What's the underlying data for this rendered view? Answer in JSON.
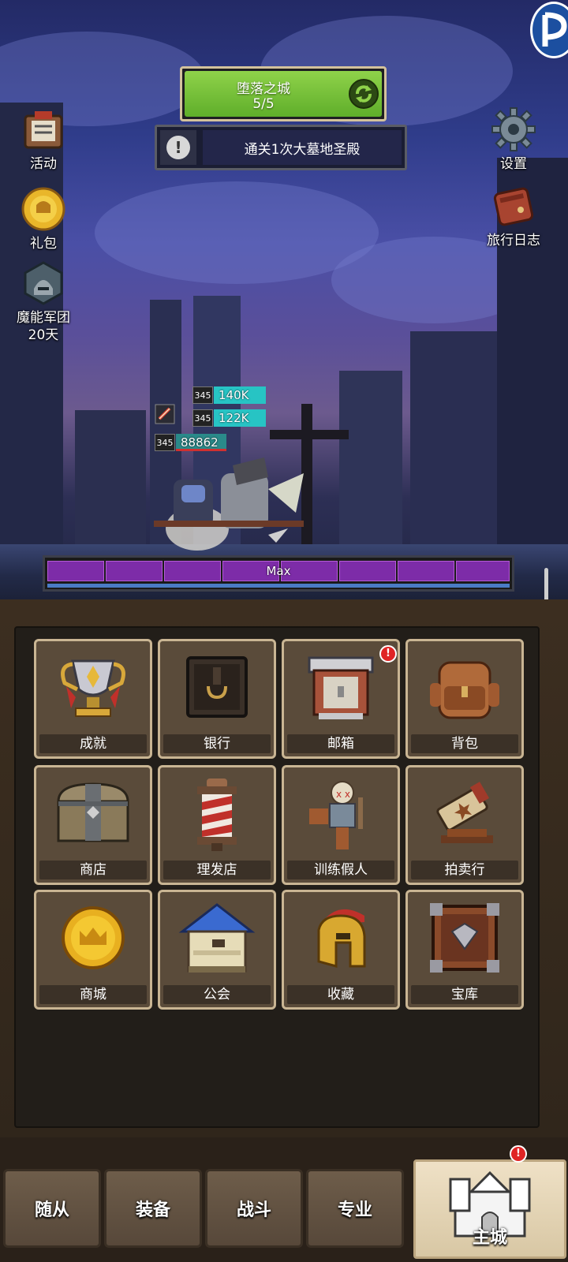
{
  "hud": {
    "stage_name": "堕落之城",
    "stage_progress": "5/5",
    "quest_text": "通关1次大墓地圣殿"
  },
  "left_menu": [
    {
      "label": "活动",
      "icon": "event-board-icon"
    },
    {
      "label": "礼包",
      "icon": "gift-pack-icon"
    },
    {
      "label": "魔能军团\n20天",
      "icon": "legion-helmet-icon"
    }
  ],
  "right_menu": [
    {
      "label": "设置",
      "icon": "gear-icon"
    },
    {
      "label": "旅行日志",
      "icon": "journal-icon"
    }
  ],
  "battle": {
    "damage_numbers": [
      {
        "level": "345",
        "value": "140K",
        "color": "#27c4c4"
      },
      {
        "level": "345",
        "value": "122K",
        "color": "#27c4c4"
      },
      {
        "level": "345",
        "value": "88862",
        "color": "#2a8a8a"
      }
    ],
    "progress_label": "Max",
    "progress_fraction": 1.0
  },
  "buildings": [
    {
      "label": "成就",
      "icon": "trophy-icon",
      "badge": false
    },
    {
      "label": "银行",
      "icon": "vault-safe-icon",
      "badge": false
    },
    {
      "label": "邮箱",
      "icon": "mailbox-icon",
      "badge": true
    },
    {
      "label": "背包",
      "icon": "backpack-icon",
      "badge": false
    },
    {
      "label": "商店",
      "icon": "chest-icon",
      "badge": false
    },
    {
      "label": "理发店",
      "icon": "barber-pole-icon",
      "badge": false
    },
    {
      "label": "训练假人",
      "icon": "training-dummy-icon",
      "badge": false
    },
    {
      "label": "拍卖行",
      "icon": "gavel-icon",
      "badge": false
    },
    {
      "label": "商城",
      "icon": "gold-crown-coin-icon",
      "badge": false
    },
    {
      "label": "公会",
      "icon": "guild-house-icon",
      "badge": false
    },
    {
      "label": "收藏",
      "icon": "spartan-helmet-icon",
      "badge": false
    },
    {
      "label": "宝库",
      "icon": "treasury-crate-icon",
      "badge": false
    }
  ],
  "bottom_nav": [
    {
      "label": "随从"
    },
    {
      "label": "装备"
    },
    {
      "label": "战斗"
    },
    {
      "label": "专业"
    },
    {
      "label": "主城",
      "active": true,
      "badge": true
    }
  ],
  "badge_symbol": "!",
  "colors": {
    "accent_green": "#7cc43c",
    "purple_bar": "#7d2ca8",
    "tile_border": "#c9b593",
    "badge_red": "#e02424"
  }
}
